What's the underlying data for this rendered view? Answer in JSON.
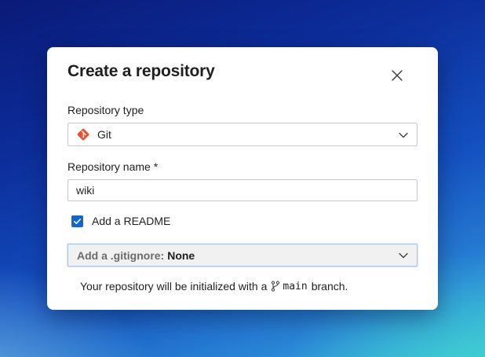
{
  "dialog": {
    "title": "Create a repository",
    "close_icon": "close-icon"
  },
  "repo_type": {
    "label": "Repository type",
    "value": "Git",
    "icon": "git-logo-icon",
    "icon_color": "#e8512f"
  },
  "repo_name": {
    "label": "Repository name *",
    "value": "wiki"
  },
  "readme": {
    "label": "Add a README",
    "checked": true,
    "color": "#1467c8"
  },
  "gitignore": {
    "prefix": "Add a .gitignore:",
    "value": "None"
  },
  "info": {
    "before": "Your repository will be initialized with a",
    "branch_icon": "branch-icon",
    "branch": "main",
    "after": "branch."
  }
}
